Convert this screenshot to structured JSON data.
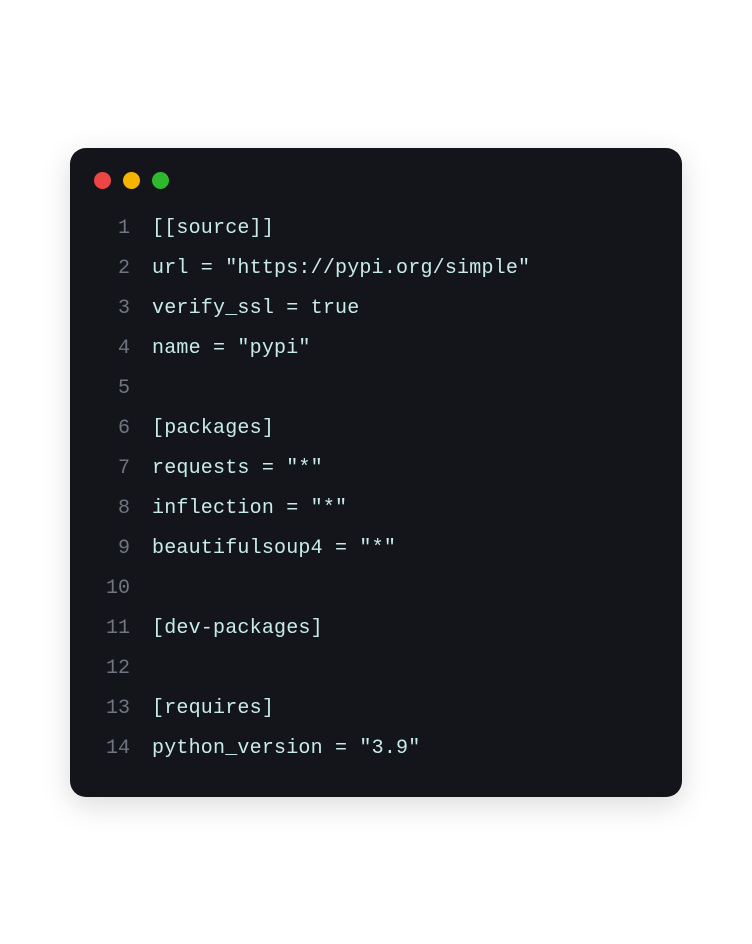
{
  "traffic_lights": {
    "red": "#ec4544",
    "yellow": "#f4b400",
    "green": "#2eb82e"
  },
  "lines": {
    "l1": {
      "num": "1",
      "text": "[[source]]"
    },
    "l2": {
      "num": "2",
      "text": "url = \"https://pypi.org/simple\""
    },
    "l3": {
      "num": "3",
      "text": "verify_ssl = true"
    },
    "l4": {
      "num": "4",
      "text": "name = \"pypi\""
    },
    "l5": {
      "num": "5",
      "text": ""
    },
    "l6": {
      "num": "6",
      "text": "[packages]"
    },
    "l7": {
      "num": "7",
      "text": "requests = \"*\""
    },
    "l8": {
      "num": "8",
      "text": "inflection = \"*\""
    },
    "l9": {
      "num": "9",
      "text": "beautifulsoup4 = \"*\""
    },
    "l10": {
      "num": "10",
      "text": ""
    },
    "l11": {
      "num": "11",
      "text": "[dev-packages]"
    },
    "l12": {
      "num": "12",
      "text": ""
    },
    "l13": {
      "num": "13",
      "text": "[requires]"
    },
    "l14": {
      "num": "14",
      "text": "python_version = \"3.9\""
    }
  }
}
